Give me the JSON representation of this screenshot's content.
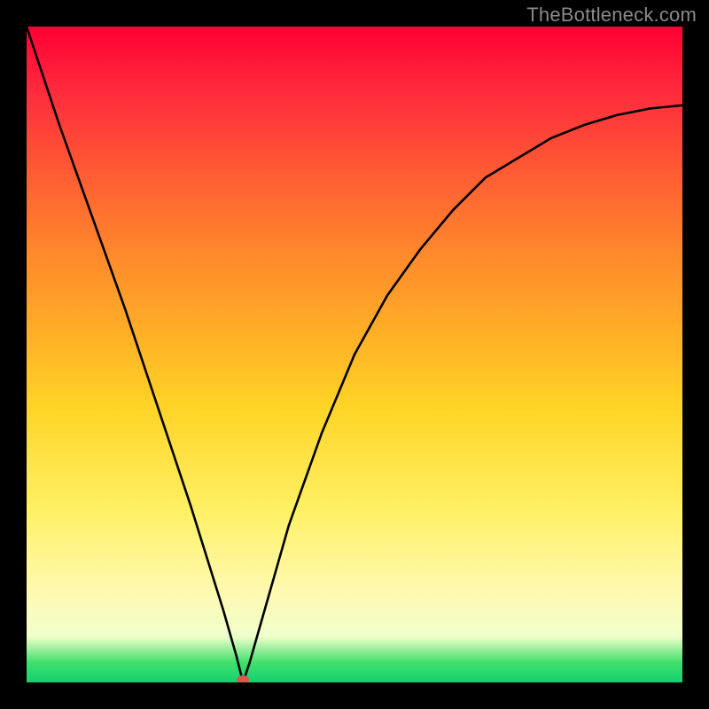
{
  "watermark": "TheBottleneck.com",
  "colors": {
    "background": "#000000",
    "gradient_top": "#ff0033",
    "gradient_bottom": "#14d070",
    "curve": "#000000",
    "marker": "#d85a4a"
  },
  "chart_data": {
    "type": "line",
    "title": "",
    "xlabel": "",
    "ylabel": "",
    "ylim": [
      0,
      100
    ],
    "xlim": [
      0,
      100
    ],
    "marker": {
      "x": 33,
      "y": 0
    },
    "series": [
      {
        "name": "curve",
        "x": [
          0,
          5,
          10,
          15,
          20,
          25,
          30,
          32,
          33,
          34,
          36,
          40,
          45,
          50,
          55,
          60,
          65,
          70,
          75,
          80,
          85,
          90,
          95,
          100
        ],
        "y": [
          100,
          85,
          71,
          57,
          42,
          27,
          11,
          4,
          0,
          3,
          10,
          24,
          38,
          50,
          59,
          66,
          72,
          77,
          80,
          83,
          85,
          86.5,
          87.5,
          88
        ]
      }
    ]
  }
}
